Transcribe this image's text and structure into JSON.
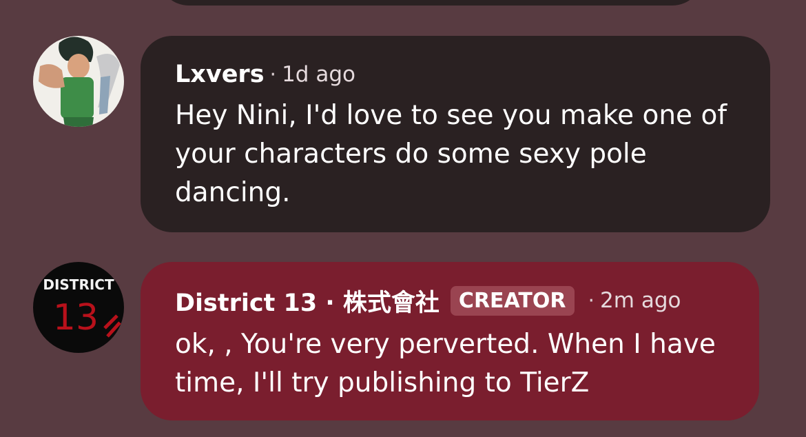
{
  "comments": [
    {
      "author": "Lxvers",
      "separator": "·",
      "time": "1d ago",
      "text": "Hey Nini, I'd love to see you make one of your characters do some sexy pole dancing."
    },
    {
      "author": "District 13 · 株式會社",
      "badge": "CREATOR",
      "separator": "·",
      "time": "2m ago",
      "text": "ok, , You're very perverted. When I have time, I'll try publishing to TierZ",
      "avatar_text_top": "DISTRICT",
      "avatar_text_num": "13"
    }
  ],
  "colors": {
    "background": "#583b41",
    "bubble_dark": "#2a2122",
    "bubble_creator": "#7a1e2e",
    "badge": "#9a4451"
  },
  "icons": [
    "avatar-anime-character",
    "avatar-district13-logo"
  ]
}
